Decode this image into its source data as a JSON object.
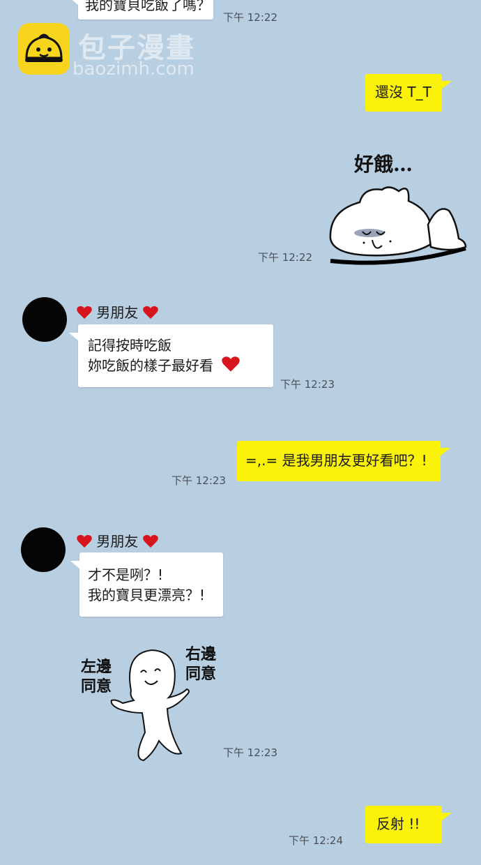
{
  "watermark": {
    "title": "包子漫畫",
    "url": "baozimh.com"
  },
  "messages": {
    "top_partial": {
      "text": "我的寶貝吃飯了嗎？",
      "time": "下午 12:22"
    },
    "m1": {
      "text": "還沒 T_T"
    },
    "m2": {
      "sticker_text": "好餓…",
      "time": "下午 12:22"
    },
    "m3": {
      "sender": "男朋友",
      "lines": [
        "記得按時吃飯",
        "妳吃飯的樣子最好看"
      ],
      "time": "下午 12:23"
    },
    "m4": {
      "text": "=,.= 是我男朋友更好看吧？!",
      "time": "下午 12:23"
    },
    "m5": {
      "sender": "男朋友",
      "lines": [
        "才不是咧？!",
        "我的寶貝更漂亮？!"
      ]
    },
    "m6": {
      "left_text": [
        "左邊",
        "同意"
      ],
      "right_text": [
        "右邊",
        "同意"
      ],
      "time": "下午 12:23"
    },
    "m7": {
      "text": "反射 !!",
      "time": "下午 12:24"
    }
  },
  "colors": {
    "background": "#b8cee1",
    "outgoing_bubble": "#fbf20a",
    "incoming_bubble": "#ffffff",
    "heart": "#d8141c",
    "logo": "#f7d51d"
  },
  "icons": [
    "heart-icon",
    "logo-icon",
    "avatar"
  ]
}
